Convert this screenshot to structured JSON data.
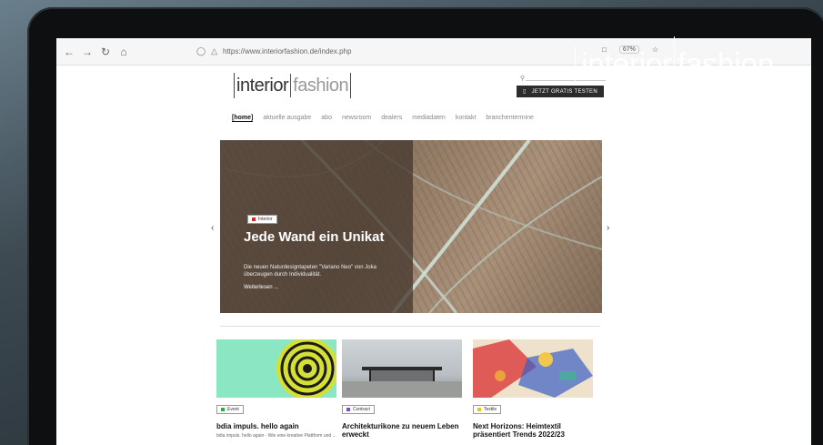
{
  "browser": {
    "url": "https://www.interiorfashion.de/index.php",
    "zoom": "67%"
  },
  "site": {
    "logo_a": "interior",
    "logo_b": "fashion",
    "cta_label": "JETZT GRATIS TESTEN",
    "menu": [
      "[home]",
      "aktuelle ausgabe",
      "abo",
      "newsroom",
      "dealers",
      "mediadaten",
      "kontakt",
      "branchentermine"
    ]
  },
  "hero": {
    "badge": "Interior",
    "title": "Jede Wand ein Unikat",
    "text": "Die neuen Naturdesigntapeten \"Variano Neo\" von Joka überzeugen durch Individualität.",
    "more": "Weiterlesen ..."
  },
  "cards": [
    {
      "badge": "Event",
      "badge_color": "#2fae3a",
      "title": "bdia impuls. hello again",
      "text": "bdia impuls. hello again - Wie eine kreative Plattform und ..."
    },
    {
      "badge": "Contract",
      "badge_color": "#7a4bd6",
      "title": "Architekturikone zu neuem Leben erweckt",
      "text": ""
    },
    {
      "badge": "Textile",
      "badge_color": "#e8c21c",
      "title": "Next Horizons: Heimtextil präsentiert Trends 2022/23",
      "text": ""
    }
  ],
  "corner_logo": {
    "a": "interior",
    "b": "fashion"
  },
  "colors": {
    "hero_badge_dot": "#d8281e"
  }
}
